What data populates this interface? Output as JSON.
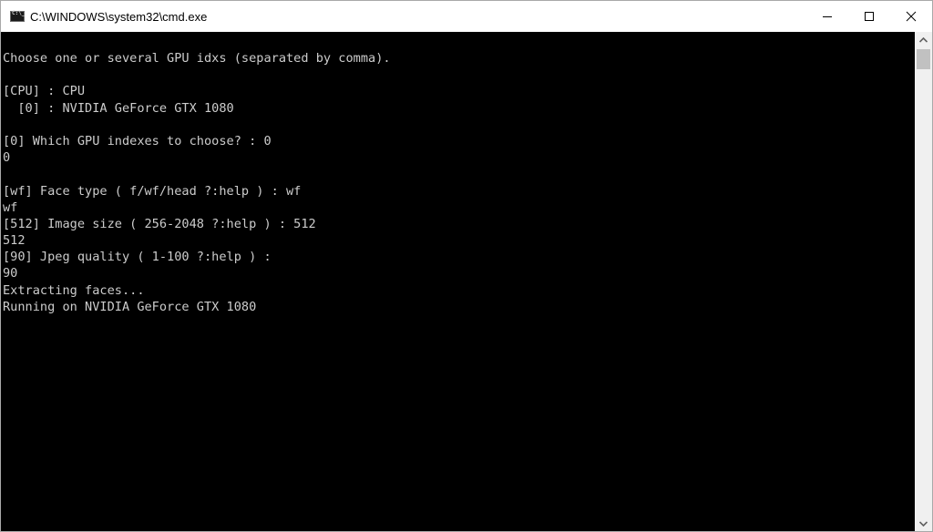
{
  "window": {
    "title": "C:\\WINDOWS\\system32\\cmd.exe",
    "icon": "cmd-icon",
    "controls": {
      "minimize": "minimize-icon",
      "maximize": "maximize-icon",
      "close": "close-icon"
    }
  },
  "console": {
    "lines": [
      "Choose one or several GPU idxs (separated by comma).",
      "",
      "[CPU] : CPU",
      "  [0] : NVIDIA GeForce GTX 1080",
      "",
      "[0] Which GPU indexes to choose? : 0",
      "0",
      "",
      "[wf] Face type ( f/wf/head ?:help ) : wf",
      "wf",
      "[512] Image size ( 256-2048 ?:help ) : 512",
      "512",
      "[90] Jpeg quality ( 1-100 ?:help ) :",
      "90",
      "Extracting faces...",
      "Running on NVIDIA GeForce GTX 1080"
    ]
  },
  "scrollbar": {
    "up_icon": "chevron-up-icon",
    "down_icon": "chevron-down-icon",
    "position": 0
  }
}
